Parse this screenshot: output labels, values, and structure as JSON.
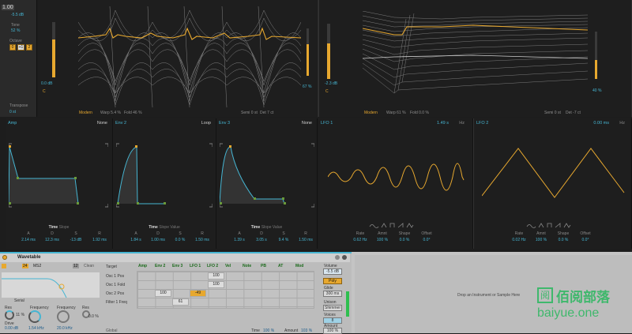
{
  "left_strip": {
    "zoom": "1.00",
    "pitch": "-5.5 dB",
    "tone_label": "Tone",
    "tone_value": "52 %",
    "octave_label": "Octave",
    "octave_buttons": [
      "0",
      "+1",
      "2"
    ],
    "transpose_label": "Transpose",
    "transpose_value": "0 st"
  },
  "osc1": {
    "gain": "0.0 dB",
    "gain_letter": "C",
    "mode": "Modern",
    "warp": "Warp  5.4 %",
    "fold": "Fold  46 %",
    "semi": "Semi  0 st",
    "det": "Det  7 ct",
    "right_value": "67 %"
  },
  "osc2": {
    "gain": "-2.3 dB",
    "gain_letter": "C",
    "mode": "Modern",
    "warp": "Warp  61 %",
    "fold": "Fold  0.0 %",
    "semi": "Semi  0 st",
    "det": "Det  -7 ct",
    "right_value": "40 %"
  },
  "amp": {
    "title": "Amp",
    "mode": "None",
    "tabs": [
      "Time",
      "Slope"
    ],
    "param_names": [
      "A",
      "D",
      "S",
      "R"
    ],
    "param_values": [
      "2.14 ms",
      "12.3 ms",
      "-13 dB",
      "1.92 ms"
    ]
  },
  "env2": {
    "title": "Env 2",
    "mode": "Loop",
    "tabs": [
      "Time",
      "Slope",
      "Value"
    ],
    "param_names": [
      "A",
      "D",
      "S",
      "R"
    ],
    "param_values": [
      "1.84 s",
      "1.00 ms",
      "0.0 %",
      "1.50 ms"
    ]
  },
  "env3": {
    "title": "Env 3",
    "mode": "None",
    "tabs": [
      "Time",
      "Slope",
      "Value"
    ],
    "param_names": [
      "A",
      "D",
      "S",
      "R"
    ],
    "param_values": [
      "1.39 s",
      "3.05 s",
      "9.4 %",
      "1.50 ms"
    ]
  },
  "lfo1": {
    "title": "LFO 1",
    "amount": "1.49 s",
    "unit": "Hz",
    "param_names": [
      "Rate",
      "Amnt",
      "Shape",
      "Offset"
    ],
    "param_values": [
      "0.62 Hz",
      "100 %",
      "0.0 %",
      "0.0°"
    ]
  },
  "lfo2": {
    "title": "LFO 2",
    "amount": "0.00 ms",
    "unit": "Hz",
    "param_names": [
      "Rate",
      "Amnt",
      "Shape",
      "Offset"
    ],
    "param_values": [
      "0.02 Hz",
      "100 %",
      "0.0 %",
      "0.0°"
    ]
  },
  "device": {
    "title": "Wavetable",
    "filter_num": "24",
    "filter_type": "MS2",
    "filter2_num": "12",
    "filter2_type": "Clean",
    "serial": "Serial",
    "res_label": "Res",
    "res_value": "11 %",
    "drive_label": "Drive",
    "drive_value": "0.00 dB",
    "freq1_label": "Frequency",
    "freq1_value": "1.54 kHz",
    "freq2_label": "Frequency",
    "freq2_value": "20.0 kHz",
    "res2_label": "Res",
    "res2_value": "0.0 %",
    "matrix_target": "Target",
    "matrix_columns": [
      "Amp",
      "Env 2",
      "Env 3",
      "LFO 1",
      "LFO 2",
      "Vel",
      "Note",
      "PB",
      "AT",
      "Mod"
    ],
    "matrix_rows": [
      "Osc 1 Pos",
      "Osc 1 Fold",
      "Osc 2 Pos",
      "Filter 1 Freq"
    ],
    "cells": {
      "r0c4": "100",
      "r1c4": "100",
      "r2c1": "100",
      "r2c3": "-49",
      "r3c2": "61"
    },
    "global": "Global",
    "time_label": "Time",
    "time_value": "100 %",
    "amount_label": "Amount",
    "amount_value": "103 %",
    "volume_label": "Volume",
    "volume_value": "-5.5 dB",
    "poly": "Poly",
    "glide_label": "Glide",
    "glide_value": "300 ms",
    "unison_label": "Unison",
    "unison_value": "Shimmer",
    "voices_label": "Voices",
    "voices_value": "8",
    "amount2_label": "Amount",
    "amount2_value": "100 %"
  },
  "drop_text": "Drop an Instrument or Sample Here",
  "watermark_cn": "佰阅部落",
  "watermark_url": "baiyue.one",
  "colors": {
    "accent": "#e7a82f",
    "cyan": "#46b5d2",
    "panel": "#1e1e1e"
  }
}
